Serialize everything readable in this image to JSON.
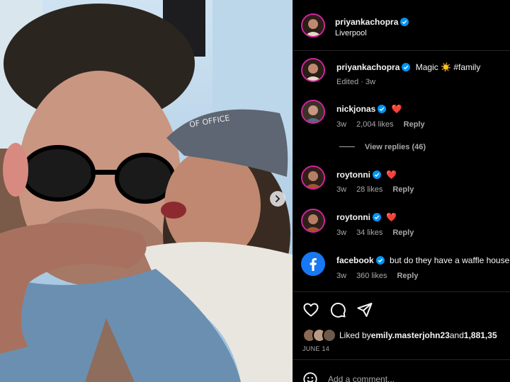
{
  "header": {
    "username": "priyankachopra",
    "location": "Liverpool"
  },
  "caption": {
    "username": "priyankachopra",
    "text": "Magic ☀️ #family",
    "meta": "Edited · 3w"
  },
  "comments": [
    {
      "username": "nickjonas",
      "text": "❤️",
      "age": "3w",
      "likes": "2,004 likes",
      "reply": "Reply"
    },
    {
      "username": "roytonni",
      "text": "❤️",
      "age": "3w",
      "likes": "28 likes",
      "reply": "Reply"
    },
    {
      "username": "roytonni",
      "text": "❤️",
      "age": "3w",
      "likes": "34 likes",
      "reply": "Reply"
    },
    {
      "username": "facebook",
      "text": "but do they have a waffle house",
      "age": "3w",
      "likes": "360 likes",
      "reply": "Reply"
    }
  ],
  "view_replies": "View replies (46)",
  "likes": {
    "prefix": "Liked by ",
    "user": "emily.masterjohn23",
    "mid": " and ",
    "count": "1,881,35"
  },
  "date": "JUNE 14",
  "comment_input": {
    "placeholder": "Add a comment..."
  },
  "colors": {
    "verified": "#0095f6",
    "heart": "#ff3040",
    "story_ring": "#d6249f",
    "facebook": "#1877f2"
  },
  "icons": [
    "heart-icon",
    "comment-icon",
    "share-icon",
    "emoji-icon",
    "verified-icon",
    "chevron-right-icon"
  ]
}
